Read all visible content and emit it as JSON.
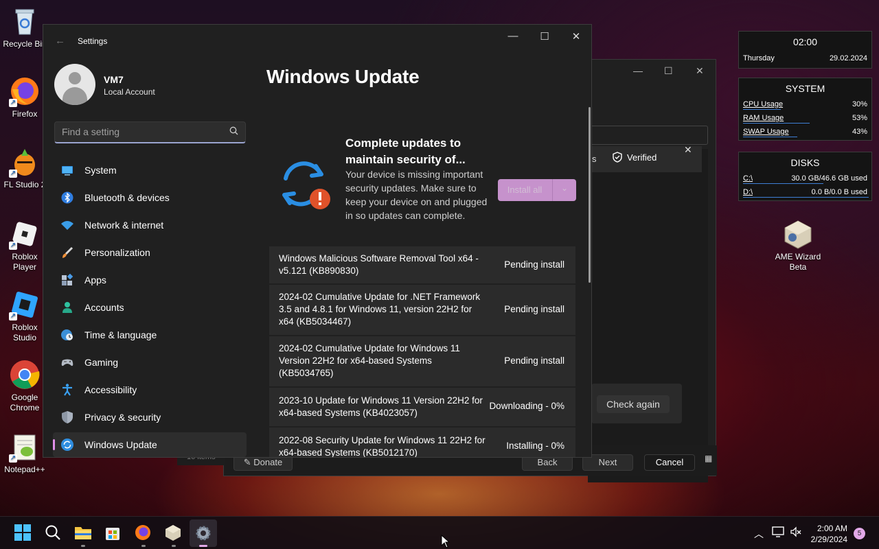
{
  "desktop": {
    "icons": [
      {
        "label": "Recycle Bin"
      },
      {
        "label": "Firefox"
      },
      {
        "label": "FL Studio 2"
      },
      {
        "label": "Roblox Player"
      },
      {
        "label": "Roblox Studio"
      },
      {
        "label": "Google Chrome"
      },
      {
        "label": "Notepad++"
      },
      {
        "label": "AME Wizard Beta"
      }
    ]
  },
  "background_window": {
    "verified_label": "Verified",
    "check_again": "Check again",
    "donate": "Donate",
    "back": "Back",
    "next": "Next",
    "cancel": "Cancel",
    "items_count": "16 items"
  },
  "settings": {
    "window_title": "Settings",
    "user": {
      "name": "VM7",
      "type": "Local Account"
    },
    "search_placeholder": "Find a setting",
    "nav": [
      {
        "label": "System"
      },
      {
        "label": "Bluetooth & devices"
      },
      {
        "label": "Network & internet"
      },
      {
        "label": "Personalization"
      },
      {
        "label": "Apps"
      },
      {
        "label": "Accounts"
      },
      {
        "label": "Time & language"
      },
      {
        "label": "Gaming"
      },
      {
        "label": "Accessibility"
      },
      {
        "label": "Privacy & security"
      },
      {
        "label": "Windows Update"
      }
    ],
    "page_title": "Windows Update",
    "status_heading": "Complete updates to maintain security of...",
    "status_description": "Your device is missing important security updates. Make sure to keep your device on and plugged in so updates can complete.",
    "install_all_label": "Install all",
    "updates": [
      {
        "name": "Windows Malicious Software Removal Tool x64 - v5.121 (KB890830)",
        "status": "Pending install"
      },
      {
        "name": "2024-02 Cumulative Update for .NET Framework 3.5 and 4.8.1 for Windows 11, version 22H2 for x64 (KB5034467)",
        "status": "Pending install"
      },
      {
        "name": "2024-02 Cumulative Update for Windows 11 Version 22H2 for x64-based Systems (KB5034765)",
        "status": "Pending install"
      },
      {
        "name": "2023-10 Update for Windows 11 Version 22H2 for x64-based Systems (KB4023057)",
        "status": "Downloading - 0%"
      },
      {
        "name": "2022-08 Security Update for Windows 11 22H2 for x64-based Systems (KB5012170)",
        "status": "Installing - 0%"
      }
    ]
  },
  "widgets": {
    "clock": {
      "time": "02:00",
      "day": "Thursday",
      "date": "29.02.2024"
    },
    "system": {
      "title": "SYSTEM",
      "rows": [
        {
          "label": "CPU Usage",
          "value": "30%",
          "fill": 0.3
        },
        {
          "label": "RAM Usage",
          "value": "53%",
          "fill": 0.53
        },
        {
          "label": "SWAP Usage",
          "value": "43%",
          "fill": 0.43
        }
      ]
    },
    "disks": {
      "title": "DISKS",
      "rows": [
        {
          "label": "C:\\",
          "value": "30.0 GB/46.6 GB used",
          "fill": 0.64
        },
        {
          "label": "D:\\",
          "value": "0.0 B/0.0 B used",
          "fill": 1.0
        }
      ]
    }
  },
  "taskbar": {
    "time": "2:00 AM",
    "date": "2/29/2024",
    "notification_count": "5"
  }
}
